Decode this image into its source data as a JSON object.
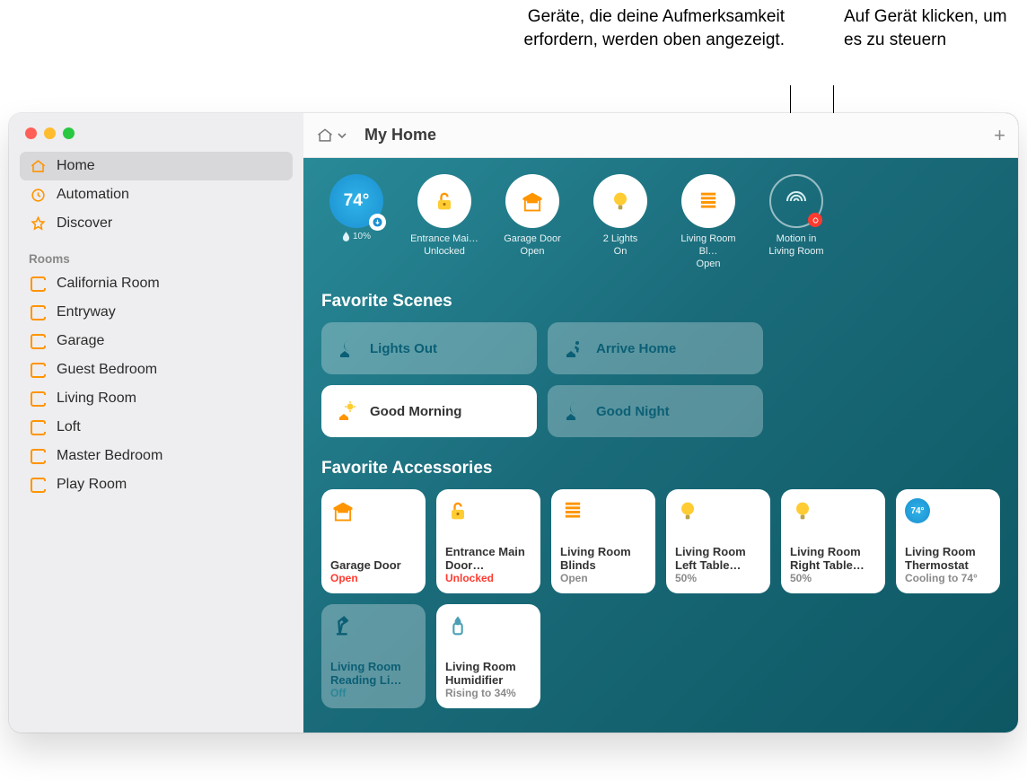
{
  "callouts": {
    "left": "Geräte, die deine Aufmerksamkeit erfordern, werden oben angezeigt.",
    "right": "Auf Gerät klicken, um es zu steuern"
  },
  "sidebar": {
    "nav": [
      {
        "label": "Home",
        "icon": "home"
      },
      {
        "label": "Automation",
        "icon": "clock"
      },
      {
        "label": "Discover",
        "icon": "star"
      }
    ],
    "rooms_header": "Rooms",
    "rooms": [
      "California Room",
      "Entryway",
      "Garage",
      "Guest Bedroom",
      "Living Room",
      "Loft",
      "Master Bedroom",
      "Play Room"
    ]
  },
  "toolbar": {
    "title": "My Home"
  },
  "status": {
    "temp": {
      "value": "74°",
      "sub_icon": "drop",
      "sub_text": "10%"
    },
    "items": [
      {
        "icon": "lock-open",
        "line1": "Entrance Mai…",
        "line2": "Unlocked"
      },
      {
        "icon": "garage-open",
        "line1": "Garage Door",
        "line2": "Open"
      },
      {
        "icon": "bulb",
        "line1": "2 Lights",
        "line2": "On"
      },
      {
        "icon": "blinds",
        "line1": "Living Room Bl…",
        "line2": "Open"
      }
    ],
    "motion": {
      "icon": "motion",
      "line1": "Motion in",
      "line2": "Living Room",
      "alert": true
    }
  },
  "scenes_header": "Favorite Scenes",
  "scenes": [
    {
      "label": "Lights Out",
      "icon": "moon-house",
      "style": "teal"
    },
    {
      "label": "Arrive Home",
      "icon": "person-house",
      "style": "teal"
    },
    {
      "label": "Good Morning",
      "icon": "sun-house",
      "style": "white"
    },
    {
      "label": "Good Night",
      "icon": "moon-house",
      "style": "teal"
    }
  ],
  "accessories_header": "Favorite Accessories",
  "accessories": [
    {
      "icon": "garage-open",
      "name": "Garage Door",
      "status": "Open",
      "status_class": "red",
      "style": "white"
    },
    {
      "icon": "lock-open",
      "name": "Entrance Main Door…",
      "status": "Unlocked",
      "status_class": "red",
      "style": "white"
    },
    {
      "icon": "blinds",
      "name": "Living Room Blinds",
      "status": "Open",
      "status_class": "gray",
      "style": "white"
    },
    {
      "icon": "bulb",
      "name": "Living Room Left Table…",
      "status": "50%",
      "status_class": "gray",
      "style": "white"
    },
    {
      "icon": "bulb",
      "name": "Living Room Right Table…",
      "status": "50%",
      "status_class": "gray",
      "style": "white"
    },
    {
      "icon": "thermostat",
      "badge": "74°",
      "name": "Living Room Thermostat",
      "status": "Cooling to 74°",
      "status_class": "gray",
      "style": "white"
    },
    {
      "icon": "desk-lamp",
      "name": "Living Room Reading Li…",
      "status": "Off",
      "status_class": "teal",
      "style": "teal"
    },
    {
      "icon": "humidifier",
      "name": "Living Room Humidifier",
      "status": "Rising to 34%",
      "status_class": "gray",
      "style": "white"
    }
  ]
}
